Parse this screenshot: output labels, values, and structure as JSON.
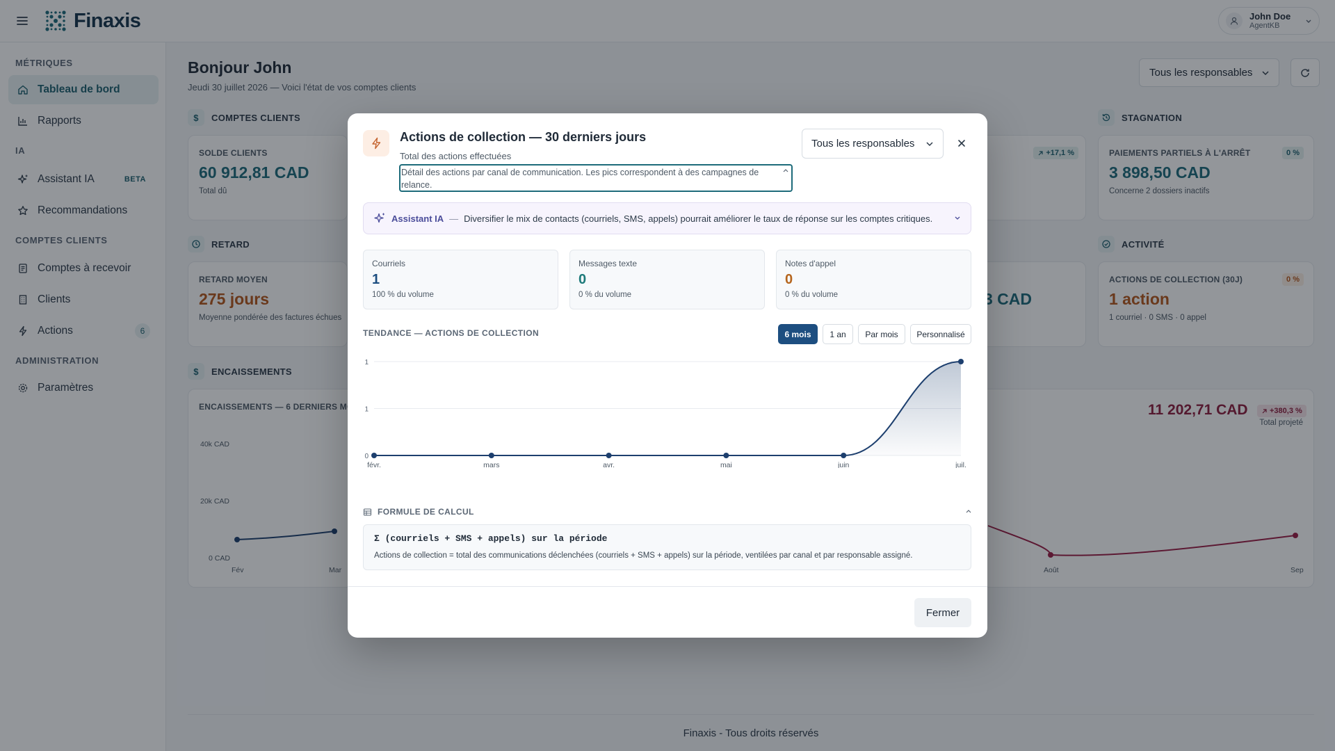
{
  "app": {
    "name": "Finaxis"
  },
  "user": {
    "name": "John Doe",
    "role": "AgentKB"
  },
  "sidebar": {
    "sections": [
      "MÉTRIQUES",
      "IA",
      "COMPTES CLIENTS",
      "ADMINISTRATION"
    ],
    "items": [
      {
        "label": "Tableau de bord",
        "icon": "home-icon",
        "active": true
      },
      {
        "label": "Rapports",
        "icon": "bar-chart-icon"
      },
      {
        "label": "Assistant IA",
        "icon": "sparkle-icon",
        "badge": "BETA"
      },
      {
        "label": "Recommandations",
        "icon": "star-icon"
      },
      {
        "label": "Comptes à recevoir",
        "icon": "document-icon"
      },
      {
        "label": "Clients",
        "icon": "building-icon"
      },
      {
        "label": "Actions",
        "icon": "lightning-icon",
        "count": "6"
      },
      {
        "label": "Paramètres",
        "icon": "gear-icon"
      }
    ]
  },
  "main": {
    "greeting": "Bonjour John",
    "subtitle": "Jeudi 30 juillet 2026 — Voici l'état de vos comptes clients",
    "responsable_select": "Tous les responsables",
    "sections": {
      "comptes_clients": "COMPTES CLIENTS",
      "stagnation": "STAGNATION",
      "retard": "RETARD",
      "activite": "ACTIVITÉ",
      "encaissements": "ENCAISSEMENTS"
    },
    "cards": {
      "solde": {
        "label": "SOLDE CLIENTS",
        "value": "60 912,81 CAD",
        "sub": "Total dû"
      },
      "stagnation_pill": "+17,1 %",
      "paiements": {
        "label": "PAIEMENTS PARTIELS À L'ARRÊT",
        "pill": "0 %",
        "value": "3 898,50 CAD",
        "sub": "Concerne 2 dossiers inactifs"
      },
      "retard": {
        "label": "RETARD MOYEN",
        "value": "275 jours",
        "sub": "Moyenne pondérée des factures échues"
      },
      "partial_value": "3 CAD",
      "actions": {
        "label": "ACTIONS DE COLLECTION (30J)",
        "pill": "0 %",
        "value": "1 action",
        "sub": "1 courriel · 0 SMS · 0 appel"
      },
      "encaissements": {
        "label": "ENCAISSEMENTS — 6 DERNIERS MOIS",
        "y_ticks": [
          "40k CAD",
          "20k CAD",
          "0 CAD"
        ],
        "x_left": [
          "Fév",
          "Mar"
        ],
        "x_right": [
          "Août",
          "Sep"
        ],
        "total": "11 202,71 CAD",
        "pill": "+380,3 %",
        "total_sub": "Total projeté"
      }
    },
    "footer": "Finaxis - Tous droits réservés"
  },
  "modal": {
    "title": "Actions de collection — 30 derniers jours",
    "subtitle": "Total des actions effectuées",
    "description": "Détail des actions par canal de communication. Les pics correspondent à des campagnes de relance.",
    "responsable_select": "Tous les responsables",
    "ai": {
      "label": "Assistant IA",
      "dash": "—",
      "text": "Diversifier le mix de contacts (courriels, SMS, appels) pourrait améliorer le taux de réponse sur les comptes critiques."
    },
    "stats": [
      {
        "label": "Courriels",
        "value": "1",
        "sub": "100 % du volume",
        "color": "#1d4e80"
      },
      {
        "label": "Messages texte",
        "value": "0",
        "sub": "0 % du volume",
        "color": "#1d7a7a"
      },
      {
        "label": "Notes d'appel",
        "value": "0",
        "sub": "0 % du volume",
        "color": "#b5651d"
      }
    ],
    "trend_title": "TENDANCE — ACTIONS DE COLLECTION",
    "ranges": [
      "6 mois",
      "1 an",
      "Par mois",
      "Personnalisé"
    ],
    "active_range": "6 mois",
    "formula": {
      "title": "FORMULE DE CALCUL",
      "code": "Σ (courriels + SMS + appels) sur la période",
      "note": "Actions de collection = total des communications déclenchées (courriels + SMS + appels) sur la période, ventilées par canal et par responsable assigné."
    },
    "close_button": "Fermer"
  },
  "chart_data": {
    "type": "area",
    "title": "TENDANCE — ACTIONS DE COLLECTION",
    "categories": [
      "févr.",
      "mars",
      "avr.",
      "mai",
      "juin",
      "juil."
    ],
    "values": [
      0,
      0,
      0,
      0,
      0,
      1
    ],
    "y_ticks": [
      "1",
      "1",
      "0"
    ],
    "ylim": [
      0,
      1
    ],
    "grid": true,
    "color": "#1d3f6e"
  }
}
